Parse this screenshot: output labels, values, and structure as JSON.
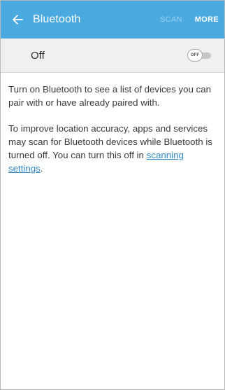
{
  "app_bar": {
    "title": "Bluetooth",
    "scan_label": "SCAN",
    "more_label": "MORE"
  },
  "toggle_row": {
    "label": "Off",
    "switch_text": "OFF"
  },
  "content": {
    "paragraph_1": "Turn on Bluetooth to see a list of devices you can pair with or have already paired with.",
    "paragraph_2_prefix": "To improve location accuracy, apps and services may scan for Bluetooth devices while Bluetooth is turned off. You can turn this off in ",
    "paragraph_2_link": "scanning settings",
    "paragraph_2_suffix": "."
  }
}
